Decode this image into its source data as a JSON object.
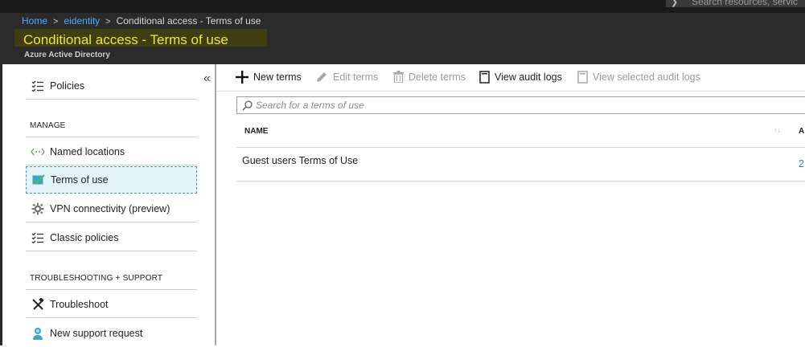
{
  "global_search": {
    "placeholder": "Search resources, servic"
  },
  "breadcrumb": {
    "home": "Home",
    "directory": "eidentity",
    "current": "Conditional access - Terms of use"
  },
  "header": {
    "title": "Conditional access - Terms of use",
    "subtitle": "Azure Active Directory"
  },
  "nav": {
    "collapse": "«",
    "policies": "Policies",
    "manage_header": "MANAGE",
    "named_locations": "Named locations",
    "terms_of_use": "Terms of use",
    "vpn": "VPN connectivity (preview)",
    "classic_policies": "Classic policies",
    "troubleshooting_header": "TROUBLESHOOTING + SUPPORT",
    "troubleshoot": "Troubleshoot",
    "new_support": "New support request"
  },
  "toolbar": {
    "new_terms": "New terms",
    "edit_terms": "Edit terms",
    "delete_terms": "Delete terms",
    "view_audit_logs": "View audit logs",
    "view_selected_audit_logs": "View selected audit logs"
  },
  "search": {
    "placeholder": "Search for a terms of use"
  },
  "table": {
    "col_name": "NAME",
    "col_second": "A",
    "sort": "↑↓",
    "rows": [
      {
        "name": "Guest users Terms of Use",
        "value": "2"
      }
    ]
  },
  "colors": {
    "accent": "#1a7fd4",
    "title": "#f0e43a",
    "header_bg": "#2b2b2b"
  }
}
